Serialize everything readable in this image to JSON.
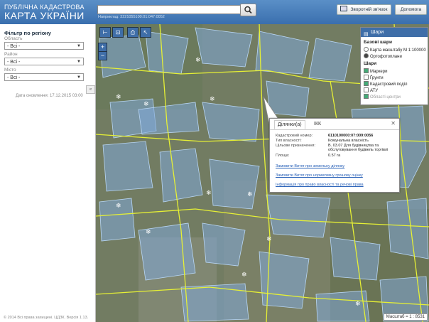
{
  "header": {
    "logo_line1": "ПУБЛІЧНА КАДАСТРОВА",
    "logo_line2": "КАРТА УКРАЇНИ",
    "search_value": "",
    "search_hint": "Наприклад: 3221055100:01:047:0052",
    "feedback_label": "Зворотній зв'язок",
    "help_label": "Допомога"
  },
  "sidebar": {
    "title": "Фільтр по регіону",
    "region_label": "Область",
    "region_value": "- Всі -",
    "district_label": "Район",
    "district_value": "- Всі -",
    "city_label": "Місто",
    "city_value": "- Всі -",
    "updated": "Дата оновлення: 17.12.2015 03:00",
    "footer": "© 2014 Всі права захищені. ЦДЗК. Версія 1.13."
  },
  "layers": {
    "title": "Шари",
    "base_title": "Базові шари",
    "base_items": [
      {
        "label": "Карта масштабу М 1:100000",
        "selected": false
      },
      {
        "label": "Ортофотоплани",
        "selected": true
      }
    ],
    "layers_title": "Шари",
    "layer_items": [
      {
        "label": "Маркери",
        "checked": true
      },
      {
        "label": "Ґрунти",
        "checked": false
      },
      {
        "label": "Кадастровий поділ",
        "checked": true
      },
      {
        "label": "АТУ",
        "checked": false
      },
      {
        "label": "Області центри",
        "checked": true
      }
    ]
  },
  "popup": {
    "tab1": "Ділянки(а)",
    "tab2": "ІКК",
    "rows": [
      {
        "key": "Кадастровий номер:",
        "value": "6110100000:07:009:0056"
      },
      {
        "key": "Тип власності:",
        "value": "Комунальна власність"
      },
      {
        "key": "Цільове призначення:",
        "value": "В. 03.07 Для будівництва та обслуговування будівель торгівлі"
      },
      {
        "key": "Площа:",
        "value": "0.57 га"
      }
    ],
    "links": [
      "Замовити Витяг про земельну ділянку",
      "Замовити Витяг про нормативну грошову оцінку",
      "Інформація про право власності та речові права"
    ]
  },
  "map": {
    "scale": "Масштаб = 1 : 8531"
  }
}
